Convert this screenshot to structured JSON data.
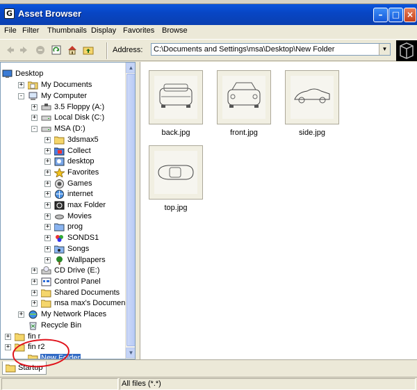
{
  "window": {
    "title": "Asset Browser"
  },
  "menu": [
    "File",
    "Filter",
    "Thumbnails",
    "Display",
    "Favorites",
    "Browse"
  ],
  "address": {
    "label": "Address:",
    "value": "C:\\Documents and Settings\\msa\\Desktop\\New Folder"
  },
  "tree": [
    {
      "label": "Desktop",
      "toggle": "",
      "icon": "desktop-icon"
    },
    {
      "label": "My Documents",
      "toggle": "+",
      "icon": "my-documents-icon"
    },
    {
      "label": "My Computer",
      "toggle": "-",
      "icon": "my-computer-icon"
    },
    {
      "label": "3.5 Floppy (A:)",
      "toggle": "+",
      "icon": "floppy-drive-icon"
    },
    {
      "label": "Local Disk (C:)",
      "toggle": "+",
      "icon": "hard-disk-icon"
    },
    {
      "label": "MSA (D:)",
      "toggle": "-",
      "icon": "hard-disk-icon"
    },
    {
      "label": "3dsmax5",
      "toggle": "+",
      "icon": "folder-icon"
    },
    {
      "label": "Collect",
      "toggle": "+",
      "icon": "collect-folder-icon"
    },
    {
      "label": "desktop",
      "toggle": "+",
      "icon": "desktop-folder-icon"
    },
    {
      "label": "Favorites",
      "toggle": "+",
      "icon": "favorites-star-icon"
    },
    {
      "label": "Games",
      "toggle": "+",
      "icon": "games-folder-icon"
    },
    {
      "label": "internet",
      "toggle": "+",
      "icon": "internet-folder-icon"
    },
    {
      "label": "max Folder",
      "toggle": "+",
      "icon": "max-folder-icon"
    },
    {
      "label": "Movies",
      "toggle": "+",
      "icon": "movies-folder-icon"
    },
    {
      "label": "prog",
      "toggle": "+",
      "icon": "prog-folder-icon"
    },
    {
      "label": "SONDS1",
      "toggle": "+",
      "icon": "sonds-folder-icon"
    },
    {
      "label": "Songs",
      "toggle": "+",
      "icon": "songs-folder-icon"
    },
    {
      "label": "Wallpapers",
      "toggle": "+",
      "icon": "wallpapers-tree-icon"
    },
    {
      "label": "CD Drive (E:)",
      "toggle": "+",
      "icon": "cd-drive-icon"
    },
    {
      "label": "Control Panel",
      "toggle": "+",
      "icon": "control-panel-icon"
    },
    {
      "label": "Shared Documents",
      "toggle": "+",
      "icon": "folder-icon"
    },
    {
      "label": "msa max's Documents",
      "toggle": "+",
      "icon": "folder-icon"
    },
    {
      "label": "My Network Places",
      "toggle": "+",
      "icon": "network-places-icon"
    },
    {
      "label": "Recycle Bin",
      "toggle": "",
      "icon": "recycle-bin-icon"
    },
    {
      "label": "fin r",
      "toggle": "+",
      "icon": "folder-icon"
    },
    {
      "label": "fin r2",
      "toggle": "+",
      "icon": "folder-icon"
    },
    {
      "label": "New Folder",
      "toggle": "",
      "icon": "folder-icon",
      "selected": true
    }
  ],
  "thumbnails": [
    {
      "caption": "back.jpg",
      "view": "car-back-view"
    },
    {
      "caption": "front.jpg",
      "view": "car-front-view"
    },
    {
      "caption": "side.jpg",
      "view": "car-side-view"
    },
    {
      "caption": "top.jpg",
      "view": "car-top-view"
    }
  ],
  "tabs": [
    {
      "label": "Startup"
    }
  ],
  "status": {
    "filter": "All files (*.*)"
  },
  "colors": {
    "title_bar": "#0a4fd8",
    "selection": "#316ac5",
    "annotation": "#e0121b"
  }
}
